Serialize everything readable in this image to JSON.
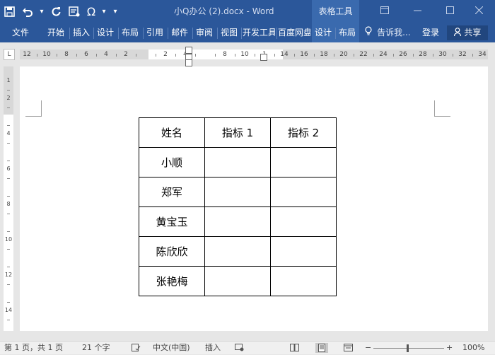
{
  "titlebar": {
    "title": "小Q办公 (2).docx - Word",
    "context_tab": "表格工具",
    "qat": {
      "save_icon": "save-icon",
      "undo_icon": "undo-icon",
      "undo_dropdown": "▾",
      "redo_icon": "redo-icon",
      "form_icon": "form-icon",
      "symbol_glyph": "Ω",
      "symbol_dropdown": "▾",
      "customize_glyph": "▾"
    },
    "window_buttons": [
      "restore-ribbon-icon",
      "minimize-icon",
      "maximize-icon",
      "close-icon"
    ]
  },
  "ribbon": {
    "tabs": [
      "文件",
      "开始",
      "插入",
      "设计",
      "布局",
      "引用",
      "邮件",
      "审阅",
      "视图",
      "开发工具",
      "百度网盘",
      "设计",
      "布局"
    ],
    "tell_me": "告诉我...",
    "login": "登录",
    "share": "共享"
  },
  "ruler": {
    "horizontal_numbers": [
      "12",
      "10",
      "8",
      "6",
      "4",
      "2",
      "",
      "2",
      "4",
      "",
      "8",
      "10",
      "1",
      "14",
      "16",
      "18",
      "20",
      "22",
      "24",
      "26",
      "28",
      "30",
      "32",
      "34"
    ],
    "vertical_numbers": [
      "1",
      "2",
      "",
      "4",
      "",
      "6",
      "",
      "8",
      "",
      "10",
      "",
      "12",
      "",
      "14"
    ]
  },
  "document": {
    "table": {
      "header": [
        "姓名",
        "指标 1",
        "指标 2"
      ],
      "rows": [
        [
          "小顺",
          "",
          ""
        ],
        [
          "郑军",
          "",
          ""
        ],
        [
          "黄宝玉",
          "",
          ""
        ],
        [
          "陈欣欣",
          "",
          ""
        ],
        [
          "张艳梅",
          "",
          ""
        ]
      ]
    }
  },
  "status": {
    "page": "第 1 页，共 1 页",
    "words": "21 个字",
    "language": "中文(中国)",
    "mode": "插入",
    "zoom_minus": "−",
    "zoom_plus": "+",
    "zoom": "100%"
  },
  "colors": {
    "ribbon_blue": "#2b579a",
    "context_blue": "#3a6aae",
    "share_blue": "#21467e"
  }
}
